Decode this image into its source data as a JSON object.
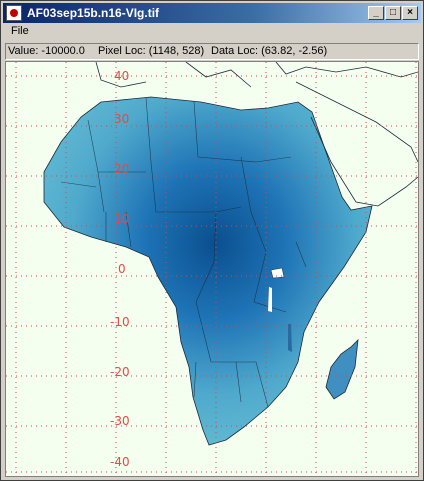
{
  "window": {
    "title": "AF03sep15b.n16-VIg.tif",
    "controls": {
      "minimize": "_",
      "maximize": "□",
      "close": "×"
    }
  },
  "menu": {
    "items": [
      "File"
    ]
  },
  "status": {
    "value_label": "Value: -10000.0",
    "pixel_loc_label": "Pixel Loc: (1148, 528)",
    "data_loc_label": "Data Loc: (63.82, -2.56)"
  },
  "map": {
    "latitude_ticks": [
      "40",
      "30",
      "20",
      "10",
      "0",
      "-10",
      "-20",
      "-30",
      "-40"
    ],
    "grid": true,
    "colors": {
      "background": "#f4fff0",
      "land_low": "#5bb7d0",
      "land_high": "#0a4f8f",
      "grid": "#d04a4a"
    }
  }
}
